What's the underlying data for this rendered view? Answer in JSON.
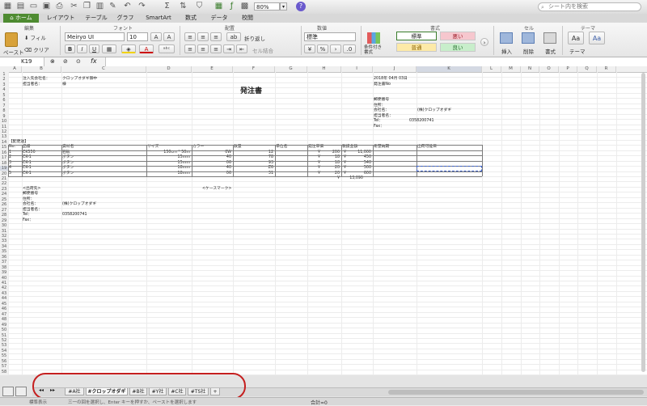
{
  "toolbar": {
    "zoom": "80%",
    "zoom_arrow": "▾",
    "search_placeholder": "シート内を検索",
    "help": "?"
  },
  "tabs": [
    "ホーム",
    "レイアウト",
    "テーブル",
    "グラフ",
    "SmartArt",
    "数式",
    "データ",
    "校閲"
  ],
  "ribbon": {
    "groups": {
      "edit": "編集",
      "font": "フォント",
      "align": "配置",
      "number": "数値",
      "format": "書式",
      "cell": "セル",
      "theme": "テーマ"
    },
    "fill_label": "フィル",
    "clear_label": "クリア",
    "paste_label": "ペースト",
    "font_name": "Meiryo UI",
    "font_size": "10",
    "wrap_label": "折り返し",
    "merge_label": "セル結合",
    "number_format": "標準",
    "cond_format": "条件付き書式",
    "styles": [
      "標準",
      "悪い",
      "普通",
      "良い"
    ],
    "insert": "挿入",
    "delete": "削除",
    "format_btn": "書式",
    "theme": "テーマ",
    "font_a": "Aa"
  },
  "formula_bar": {
    "cell_ref": "K19",
    "fx": "fx"
  },
  "columns": [
    "A",
    "B",
    "C",
    "D",
    "E",
    "F",
    "G",
    "H",
    "I",
    "J",
    "K",
    "L",
    "M",
    "N",
    "O",
    "P",
    "Q",
    "R"
  ],
  "rows_count": 58,
  "sheet": {
    "recipient_company_label": "注入先会社名：",
    "recipient_company": "クロップオダギ御中",
    "recipient_person_label": "担当者名：",
    "recipient_person": "様",
    "title": "発注書",
    "date": "2018年 04月 03日",
    "order_no_label": "発注書No",
    "postal_label": "郵便番号",
    "address_label": "住所：",
    "company_label": "会社名：",
    "company_value": "(株)クロップオダギ",
    "person_label": "担当者名：",
    "tel_label": "Tel：",
    "tel_value": "0358200741",
    "fax_label": "Fax：",
    "section_label": "【配更送】",
    "table_headers": [
      "No.",
      "品番",
      "資材名",
      "サイズ",
      "カラー",
      "数量",
      "単位名",
      "発注単価",
      "税抜金額",
      "希望納期",
      "出荷可能日"
    ],
    "table_rows": [
      [
        "1",
        "CK550",
        "石板",
        "150cm * 50m",
        "0W",
        "12",
        "",
        "¥",
        "200",
        "¥",
        "11,000"
      ],
      [
        "2",
        "CK-1",
        "ボタン",
        "15mm",
        "40",
        "78",
        "",
        "¥",
        "18",
        "¥",
        "450"
      ],
      [
        "3",
        "CK-1",
        "ボタン",
        "15mm",
        "06",
        "93",
        "",
        "¥",
        "18",
        "¥",
        "540"
      ],
      [
        "4",
        "CK-1",
        "ボタン",
        "18mm",
        "40",
        "Z6",
        "",
        "¥",
        "20",
        "¥",
        "500"
      ],
      [
        "5",
        "CK-1",
        "ボタン",
        "18mm",
        "06",
        "31",
        "",
        "¥",
        "20",
        "¥",
        "600"
      ]
    ],
    "total_yen": "¥",
    "total": "13,090",
    "shipto_label": "<出荷先>",
    "caremark": "<ケースマーク>",
    "ship_postal": "郵便番号",
    "ship_address": "住所：",
    "ship_company_label": "会社名：",
    "ship_company": "(株)クロップオダギ",
    "ship_person": "担当者名：",
    "ship_tel_label": "Tel：",
    "ship_tel": "0358200741",
    "ship_fax": "Fax："
  },
  "sheet_tabs": [
    "#A社",
    "#クロップオダギ",
    "#B社",
    "#Y社",
    "#C社",
    "#TS社",
    "+"
  ],
  "status": {
    "mode": "標準表示",
    "sum": "合計=0",
    "hint": "三一の回を選択し、Enter キーを押すか、ペーストを選択します"
  }
}
